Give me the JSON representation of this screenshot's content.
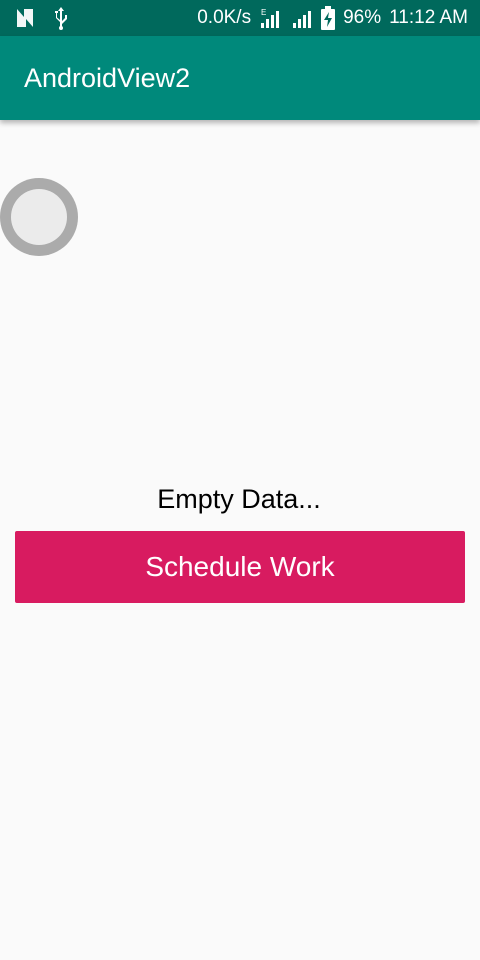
{
  "status_bar": {
    "net_speed": "0.0K/s",
    "battery_percent": "96%",
    "time": "11:12 AM",
    "icons": [
      "n-icon",
      "usb-icon",
      "signal-e-icon",
      "signal-icon",
      "battery-charging-icon"
    ]
  },
  "app_bar": {
    "title": "AndroidView2",
    "color": "#00897b"
  },
  "main": {
    "status_text": "Empty Data...",
    "button_label": "Schedule Work",
    "button_color": "#d81b60"
  }
}
